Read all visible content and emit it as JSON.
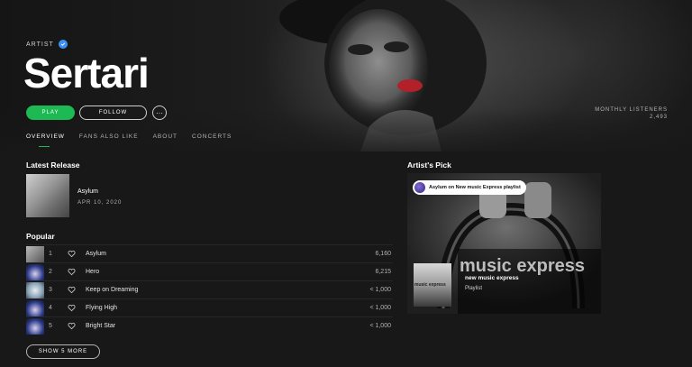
{
  "artist": {
    "label": "ARTIST",
    "name": "Sertari",
    "monthly_listeners_label": "MONTHLY LISTENERS",
    "monthly_listeners": "2,493"
  },
  "actions": {
    "play": "PLAY",
    "follow": "FOLLOW",
    "more": "···"
  },
  "tabs": [
    {
      "label": "OVERVIEW",
      "active": true
    },
    {
      "label": "FANS ALSO LIKE",
      "active": false
    },
    {
      "label": "ABOUT",
      "active": false
    },
    {
      "label": "CONCERTS",
      "active": false
    }
  ],
  "latest_release": {
    "section_title": "Latest Release",
    "name": "Asylum",
    "date": "APR 10, 2020"
  },
  "popular": {
    "section_title": "Popular",
    "tracks": [
      {
        "num": "1",
        "title": "Asylum",
        "plays": "6,160"
      },
      {
        "num": "2",
        "title": "Hero",
        "plays": "6,215"
      },
      {
        "num": "3",
        "title": "Keep on Dreaming",
        "plays": "< 1,000"
      },
      {
        "num": "4",
        "title": "Flying High",
        "plays": "< 1,000"
      },
      {
        "num": "5",
        "title": "Bright Star",
        "plays": "< 1,000"
      }
    ],
    "show_more": "SHOW 5 MORE"
  },
  "artists_pick": {
    "section_title": "Artist's Pick",
    "badge": "Asylum on New music Express playlist",
    "brand_text": "music express",
    "thumb_text": "music express",
    "playlist_name": "new music express",
    "playlist_type": "Playlist"
  },
  "colors": {
    "accent": "#1db954",
    "background": "#181818",
    "verified": "#3d91f4"
  }
}
